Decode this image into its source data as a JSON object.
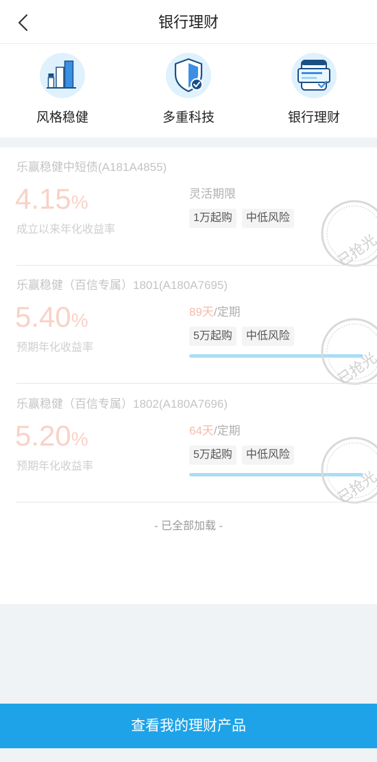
{
  "header": {
    "title": "银行理财",
    "back_icon": "chevron-left-icon"
  },
  "features": [
    {
      "icon": "bar-chart-icon",
      "label": "风格稳健"
    },
    {
      "icon": "shield-check-icon",
      "label": "多重科技"
    },
    {
      "icon": "bank-card-check-icon",
      "label": "银行理财"
    }
  ],
  "products": [
    {
      "name": "乐赢稳健中短债(A181A4855)",
      "rate": "4.15",
      "rate_unit": "%",
      "rate_label": "成立以来年化收益率",
      "term": "灵活期限",
      "tags": [
        "1万起购",
        "中低风险"
      ],
      "stamp": "已抢光"
    },
    {
      "name": "乐赢稳健（百信专属）1801(A180A7695)",
      "rate": "5.40",
      "rate_unit": "%",
      "rate_label": "预期年化收益率",
      "term_days": "89天",
      "term": "/定期",
      "tags": [
        "5万起购",
        "中低风险"
      ],
      "progress_percent": 100,
      "stamp": "已抢光"
    },
    {
      "name": "乐赢稳健（百信专属）1802(A180A7696)",
      "rate": "5.20",
      "rate_unit": "%",
      "rate_label": "预期年化收益率",
      "term_days": "64天",
      "term": "/定期",
      "tags": [
        "5万起购",
        "中低风险"
      ],
      "progress_percent": 100,
      "stamp": "已抢光"
    }
  ],
  "list_end_note": "- 已全部加载 -",
  "cta": {
    "label": "查看我的理财产品"
  },
  "colors": {
    "brand_blue": "#1fa3e8",
    "rate_faded": "#f8d2c7",
    "term_days_faded": "#f5bcab",
    "progress_fill": "#a9ddf5",
    "page_bg": "#f0f3f5"
  }
}
